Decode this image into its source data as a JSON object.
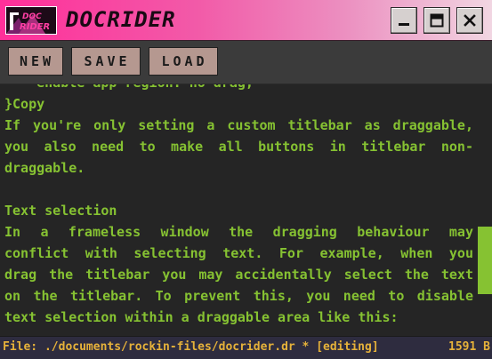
{
  "window": {
    "title": "DOCRIDER",
    "logo_text": "DOC RIDER",
    "controls": [
      "minimize",
      "maximize",
      "close"
    ]
  },
  "toolbar": {
    "new_label": "NEW",
    "save_label": "SAVE",
    "load_label": "LOAD"
  },
  "editor": {
    "lines": [
      "    enable-app-region: no-drag;",
      "}Copy",
      "If you're only setting a custom titlebar as draggable,",
      "you also need to make all buttons in titlebar non-",
      "draggable.",
      "",
      "Text selection",
      "In a frameless window the dragging behaviour may",
      "conflict with selecting text. For example, when you",
      "drag the titlebar you may accidentally select the text",
      "on the titlebar. To prevent this, you need to disable",
      "text selection within a draggable area like this:"
    ]
  },
  "status": {
    "file_path": "File: ./documents/rockin-files/docrider.dr * [editing]",
    "size": "1591 B"
  },
  "colors": {
    "titlebar_accent": "#ff2f9a",
    "text": "#86c232",
    "status_text": "#e6b23a",
    "button_bg": "#b59890"
  },
  "icons": [
    "app-logo-icon",
    "minimize-icon",
    "maximize-icon",
    "close-icon"
  ]
}
